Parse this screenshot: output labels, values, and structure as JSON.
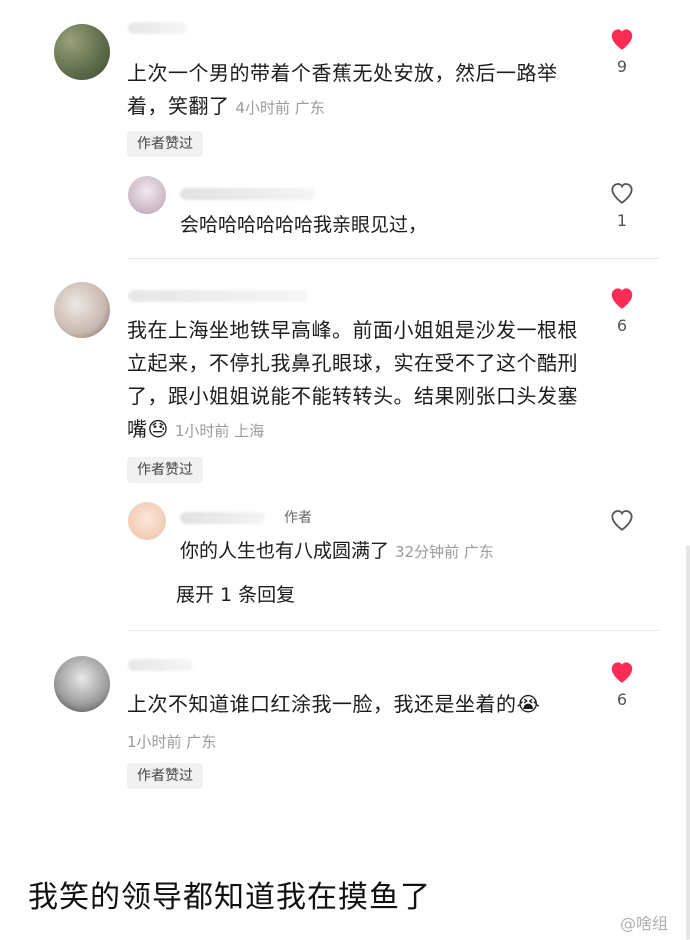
{
  "comments": [
    {
      "text": "上次一个男的带着个香蕉无处安放，然后一路举着，笑翻了",
      "meta": "4小时前 广东",
      "chip": "作者赞过",
      "likes": "9",
      "liked": true,
      "reply": {
        "text": "会哈哈哈哈哈哈我亲眼见过，",
        "likes": "1"
      }
    },
    {
      "text": "我在上海坐地铁早高峰。前面小姐姐是沙发一根根立起来，不停扎我鼻孔眼球，实在受不了这个酷刑了，跟小姐姐说能不能转转头。结果刚张口头发塞嘴😓",
      "meta": "1小时前 上海",
      "chip": "作者赞过",
      "likes": "6",
      "liked": true,
      "reply": {
        "author_tag": "作者",
        "text": "你的人生也有八成圆满了",
        "meta": "32分钟前 广东",
        "expand": "展开 1 条回复"
      }
    },
    {
      "text": "上次不知道谁口红涂我一脸，我还是坐着的😭",
      "meta": "1小时前 广东",
      "chip": "作者赞过",
      "likes": "6",
      "liked": true
    }
  ],
  "caption": "我笑的领导都知道我在摸鱼了",
  "watermark": "@啥组",
  "colors": {
    "like_red": "#fe2c55",
    "muted": "#9b9b9b"
  }
}
